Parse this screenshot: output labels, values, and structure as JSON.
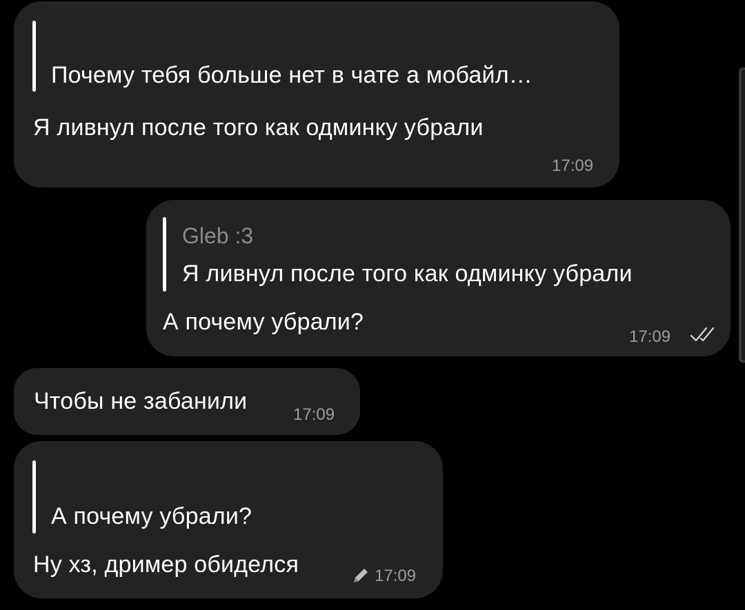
{
  "messages": [
    {
      "direction": "incoming",
      "reply_text": "Почему тебя больше нет в чате а мобайл…",
      "text": "Я ливнул после того как одминку убрали",
      "time": "17:09"
    },
    {
      "direction": "outgoing",
      "reply_author": "Gleb :3",
      "reply_text": "Я ливнул после того как одминку убрали",
      "text": "А почему убрали?",
      "time": "17:09",
      "status_icon": "double-check-icon"
    },
    {
      "direction": "incoming",
      "text": "Чтобы не забанили",
      "time": "17:09"
    },
    {
      "direction": "incoming",
      "reply_text": "А почему убрали?",
      "text": "Ну хз, дример обиделся",
      "time": "17:09",
      "edited_icon": "pencil-icon"
    }
  ],
  "colors": {
    "background": "#000000",
    "bubble": "#232323",
    "text": "#ffffff",
    "meta": "#9a9a9a",
    "quote_author": "#8a8a8a"
  }
}
